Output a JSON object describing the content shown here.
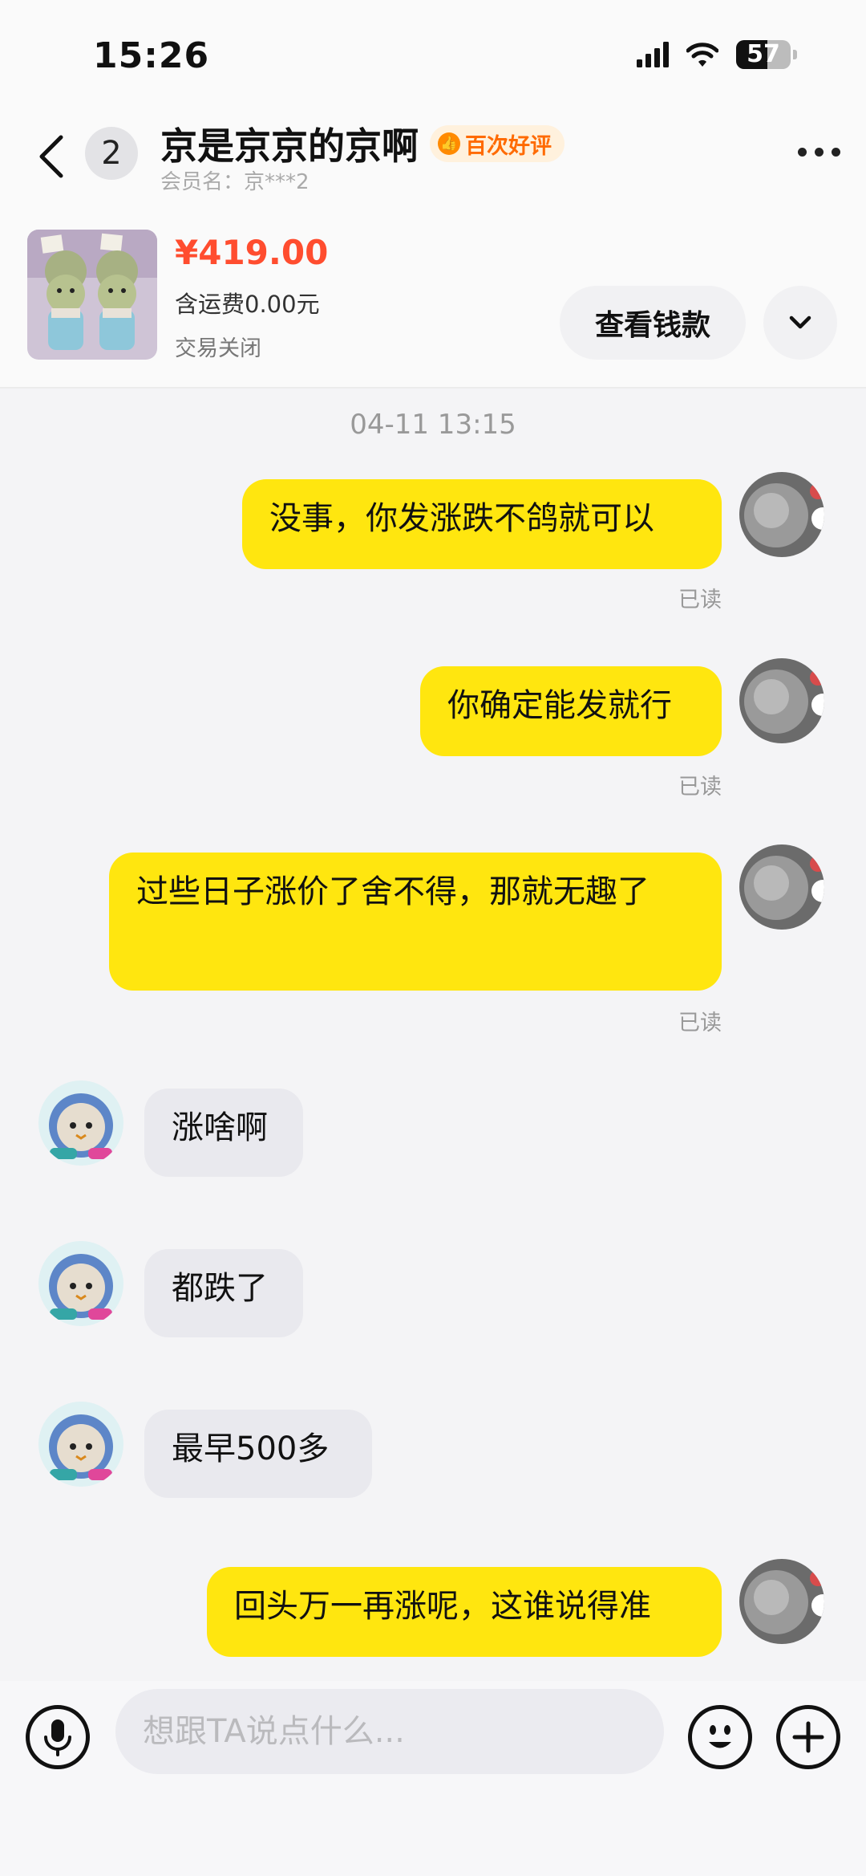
{
  "status_bar": {
    "time": "15:26",
    "battery": "57",
    "battery_level": 0.57,
    "icons": [
      "signal-icon",
      "wifi-icon",
      "battery-icon"
    ]
  },
  "header": {
    "unread_count": "2",
    "title": "京是京京的京啊",
    "badge": "百次好评",
    "member": "会员名：京***2"
  },
  "product": {
    "price": "¥419.00",
    "shipping": "含运费0.00元",
    "status": "交易关闭",
    "view_button": "查看钱款"
  },
  "chat": {
    "timestamp": "04-11 13:15",
    "read_label": "已读",
    "messages": [
      {
        "from": "me",
        "text": "没事，你发涨跌不鸽就可以",
        "read": "已读"
      },
      {
        "from": "me",
        "text": "你确定能发就行",
        "read": "已读"
      },
      {
        "from": "me",
        "text": "过些日子涨价了舍不得，那就无趣了",
        "read": "已读"
      },
      {
        "from": "other",
        "text": "涨啥啊"
      },
      {
        "from": "other",
        "text": "都跌了"
      },
      {
        "from": "other",
        "text": "最早500多"
      },
      {
        "from": "me",
        "text": "回头万一再涨呢，这谁说得准"
      }
    ]
  },
  "input": {
    "placeholder": "想跟TA说点什么..."
  },
  "colors": {
    "my_bubble": "#ffe60f",
    "their_bubble": "#e9e9ee",
    "price": "#ff4d2f",
    "badge": "#ff6a00"
  }
}
